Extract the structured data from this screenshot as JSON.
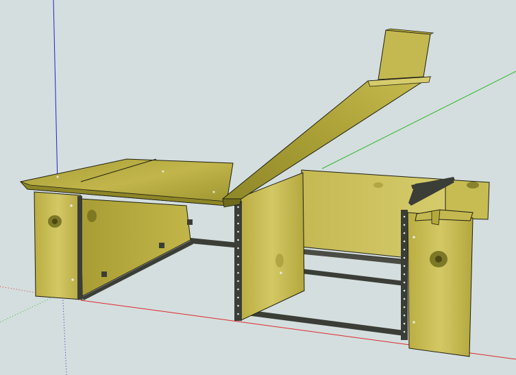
{
  "scene": {
    "viewport_background": "#d4dede",
    "axis_colors": {
      "red": "#e0262a",
      "green": "#2fb52f",
      "blue": "#2222cc"
    },
    "materials": {
      "plywood_light": "#c9bd55",
      "plywood_mid": "#b4a83c",
      "plywood_dark": "#8d8527",
      "plywood_shadow": "#6f6a1e",
      "steel_rail": "#3b3d37",
      "steel_rail_light": "#6a6c64",
      "bolt_hole": "#e8e8e0",
      "knot": "#5e5418",
      "edge_line": "#1e1e12"
    }
  }
}
